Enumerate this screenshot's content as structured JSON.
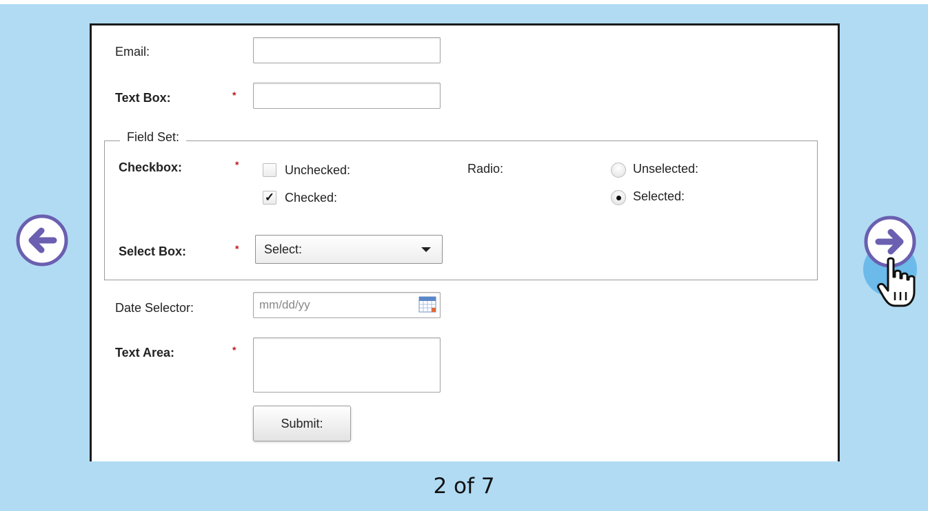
{
  "form": {
    "email_label": "Email:",
    "text_box_label": "Text Box:",
    "required_mark": "*",
    "fieldset": {
      "legend": "Field Set:",
      "checkbox_label": "Checkbox:",
      "unchecked_label": "Unchecked:",
      "checked_label": "Checked:",
      "checked_mark": "✓",
      "radio_label": "Radio:",
      "unselected_label": "Unselected:",
      "selected_label": "Selected:",
      "select_box_label": "Select Box:",
      "select_value": "Select:"
    },
    "date_selector_label": "Date Selector:",
    "date_placeholder": "mm/dd/yy",
    "text_area_label": "Text Area:",
    "submit_label": "Submit:"
  },
  "pager": {
    "text": "2 of 7"
  },
  "colors": {
    "background": "#b1dbf3",
    "arrow": "#6a5fb0",
    "required": "#c0151c"
  }
}
